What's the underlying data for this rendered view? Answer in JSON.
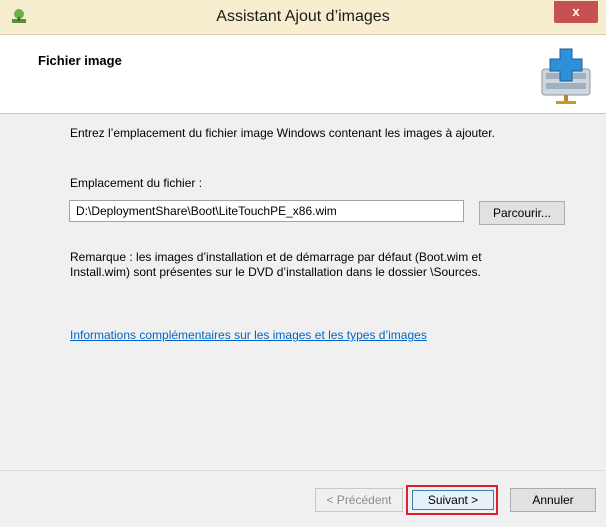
{
  "window": {
    "title": "Assistant Ajout d’images",
    "close_label": "x"
  },
  "header": {
    "heading": "Fichier image"
  },
  "content": {
    "intro_text": "Entrez l’emplacement du fichier image Windows contenant les images à ajouter.",
    "location_label": "Emplacement du fichier :",
    "location_value": "D:\\DeploymentShare\\Boot\\LiteTouchPE_x86.wim",
    "browse_label": "Parcourir...",
    "note_text": "Remarque : les images d’installation et de démarrage par défaut (Boot.wim et Install.wim) sont présentes sur le DVD d’installation dans le dossier \\Sources.",
    "info_link": "Informations complémentaires sur les images et les types d’images"
  },
  "footer": {
    "prev_label": "< Précédent",
    "next_label": "Suivant >",
    "cancel_label": "Annuler"
  },
  "colors": {
    "titlebar": "#f6eecf",
    "close_button": "#c75050",
    "link": "#0066cc",
    "highlight": "#e01f2d"
  }
}
